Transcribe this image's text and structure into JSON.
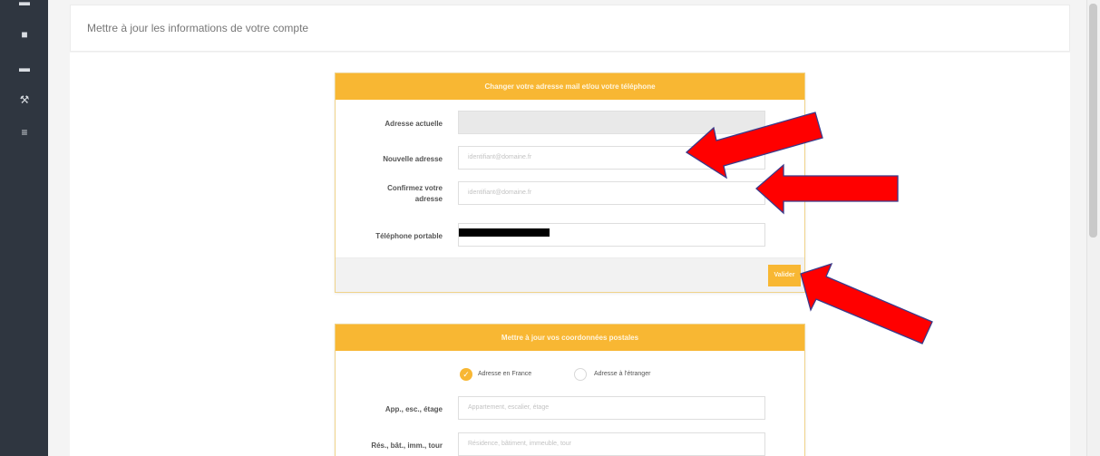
{
  "sidebar": {
    "icons": [
      {
        "name": "dashboard-icon",
        "glyph": "■"
      },
      {
        "name": "card-icon",
        "glyph": "▬"
      },
      {
        "name": "tools-icon",
        "glyph": "⚒"
      },
      {
        "name": "list-icon",
        "glyph": "≡"
      }
    ]
  },
  "header": {
    "title": "Mettre à jour les informations de votre compte"
  },
  "email_panel": {
    "title": "Changer votre adresse mail et/ou votre téléphone",
    "current_label": "Adresse actuelle",
    "new_label": "Nouvelle adresse",
    "new_placeholder": "identifiant@domaine.fr",
    "confirm_label_1": "Confirmez votre",
    "confirm_label_2": "adresse",
    "confirm_placeholder": "identifiant@domaine.fr",
    "phone_label": "Téléphone portable",
    "submit_label": "Valider"
  },
  "postal_panel": {
    "title": "Mettre à jour vos coordonnées postales",
    "radio_france": "Adresse en France",
    "radio_abroad": "Adresse à l'étranger",
    "app_label": "App., esc., étage",
    "app_placeholder": "Appartement, escalier, étage",
    "res_label": "Rés., bât., imm., tour",
    "res_placeholder": "Résidence, bâtiment, immeuble, tour"
  },
  "colors": {
    "accent": "#f8b733",
    "sidebar": "#2f3640",
    "arrow": "#ff0000"
  }
}
